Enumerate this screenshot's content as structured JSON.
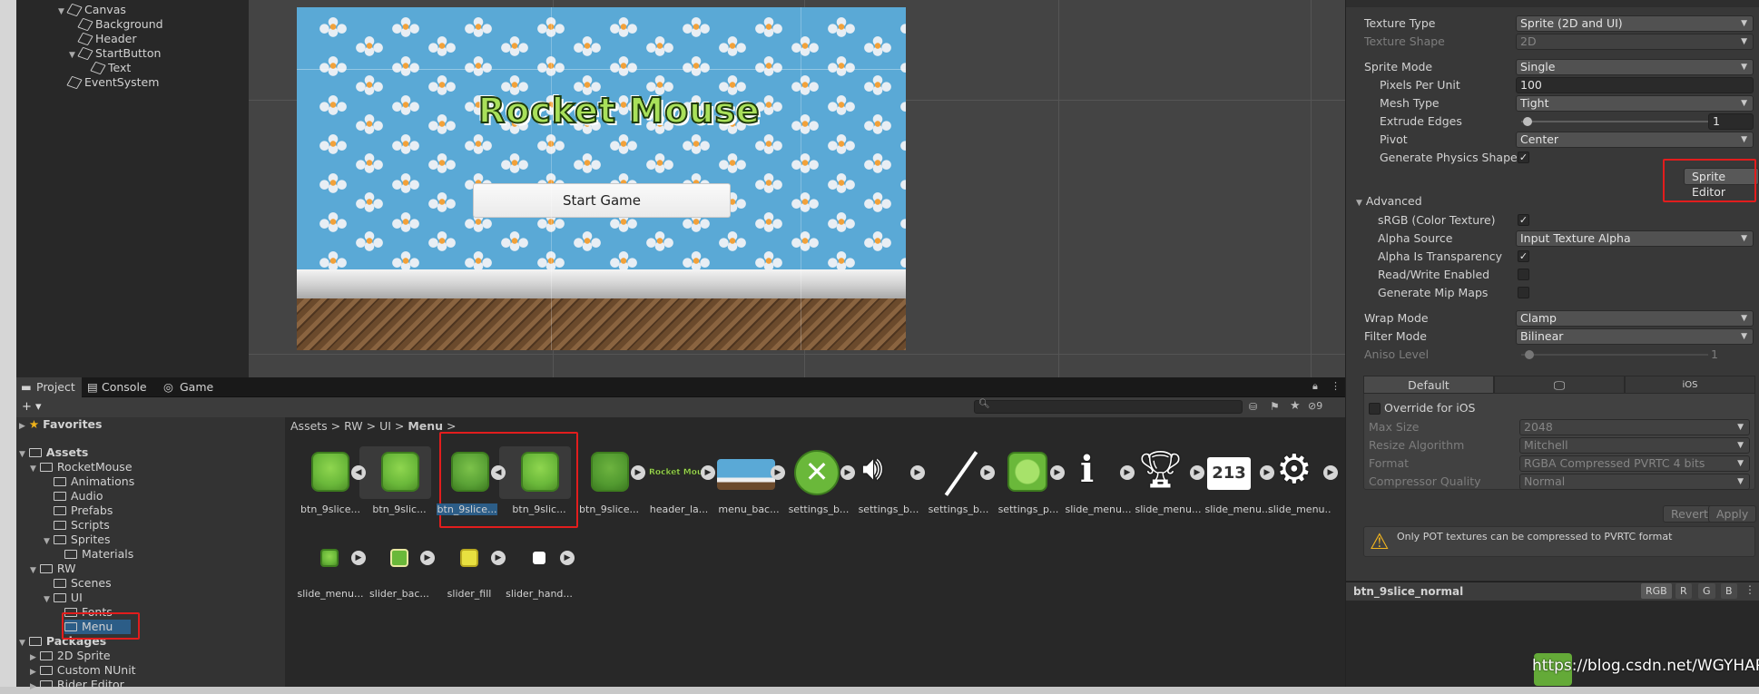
{
  "hierarchy": {
    "items": [
      {
        "label": "Canvas"
      },
      {
        "label": "Background"
      },
      {
        "label": "Header"
      },
      {
        "label": "StartButton"
      },
      {
        "label": "Text"
      },
      {
        "label": "EventSystem"
      }
    ]
  },
  "scene": {
    "game_title": "Rocket Mouse",
    "start_button": "Start Game"
  },
  "project": {
    "tabs": [
      {
        "label": "Project"
      },
      {
        "label": "Console"
      },
      {
        "label": "Game"
      }
    ],
    "add_label": "+ ▾",
    "hidden_count": "9",
    "tree": [
      {
        "label": "Favorites"
      },
      {
        "label": "Assets"
      },
      {
        "label": "RocketMouse"
      },
      {
        "label": "Animations"
      },
      {
        "label": "Audio"
      },
      {
        "label": "Prefabs"
      },
      {
        "label": "Scripts"
      },
      {
        "label": "Sprites"
      },
      {
        "label": "Materials"
      },
      {
        "label": "RW"
      },
      {
        "label": "Scenes"
      },
      {
        "label": "UI"
      },
      {
        "label": "Fonts"
      },
      {
        "label": "Menu"
      },
      {
        "label": "Packages"
      },
      {
        "label": "2D Sprite"
      },
      {
        "label": "Custom NUnit"
      },
      {
        "label": "Rider Editor"
      }
    ],
    "breadcrumb": [
      "Assets",
      "RW",
      "UI",
      "Menu"
    ],
    "assets": [
      {
        "label": "btn_9slice..."
      },
      {
        "label": "btn_9slic..."
      },
      {
        "label": "btn_9slice..."
      },
      {
        "label": "btn_9slic..."
      },
      {
        "label": "btn_9slice..."
      },
      {
        "label": "header_la..."
      },
      {
        "label": "menu_bac..."
      },
      {
        "label": "settings_b..."
      },
      {
        "label": "settings_b..."
      },
      {
        "label": "settings_b..."
      },
      {
        "label": "settings_p..."
      },
      {
        "label": "slide_menu..."
      },
      {
        "label": "slide_menu..."
      },
      {
        "label": "slide_menu..."
      },
      {
        "label": "slide_menu..."
      },
      {
        "label": "slide_menu..."
      },
      {
        "label": "slider_bac..."
      },
      {
        "label": "slider_fill"
      },
      {
        "label": "slider_hand..."
      }
    ],
    "header_thumb_text": "Rocket Mouse"
  },
  "inspector": {
    "texture_type": {
      "label": "Texture Type",
      "value": "Sprite (2D and UI)"
    },
    "texture_shape": {
      "label": "Texture Shape",
      "value": "2D"
    },
    "sprite_mode": {
      "label": "Sprite Mode",
      "value": "Single"
    },
    "ppu": {
      "label": "Pixels Per Unit",
      "value": "100"
    },
    "mesh_type": {
      "label": "Mesh Type",
      "value": "Tight"
    },
    "extrude": {
      "label": "Extrude Edges",
      "value": "1"
    },
    "pivot": {
      "label": "Pivot",
      "value": "Center"
    },
    "gen_physics": {
      "label": "Generate Physics Shape"
    },
    "sprite_editor": "Sprite Editor",
    "advanced": "Advanced",
    "srgb": {
      "label": "sRGB (Color Texture)"
    },
    "alpha_source": {
      "label": "Alpha Source",
      "value": "Input Texture Alpha"
    },
    "alpha_transp": {
      "label": "Alpha Is Transparency"
    },
    "read_write": {
      "label": "Read/Write Enabled"
    },
    "mipmaps": {
      "label": "Generate Mip Maps"
    },
    "wrap_mode": {
      "label": "Wrap Mode",
      "value": "Clamp"
    },
    "filter_mode": {
      "label": "Filter Mode",
      "value": "Bilinear"
    },
    "aniso": {
      "label": "Aniso Level",
      "value": "1"
    },
    "platform_tabs": {
      "default": "Default",
      "ios": "iOS"
    },
    "override": "Override for iOS",
    "max_size": {
      "label": "Max Size",
      "value": "2048"
    },
    "resize": {
      "label": "Resize Algorithm",
      "value": "Mitchell"
    },
    "format": {
      "label": "Format",
      "value": "RGBA Compressed PVRTC 4 bits"
    },
    "compressor": {
      "label": "Compressor Quality",
      "value": "Normal"
    },
    "revert": "Revert",
    "apply": "Apply",
    "warning": "Only POT textures can be compressed to PVRTC format",
    "preview_name": "btn_9slice_normal",
    "channels": [
      "RGB",
      "R",
      "G",
      "B"
    ]
  },
  "watermark": "https://blog.csdn.net/WGYHAPPY"
}
